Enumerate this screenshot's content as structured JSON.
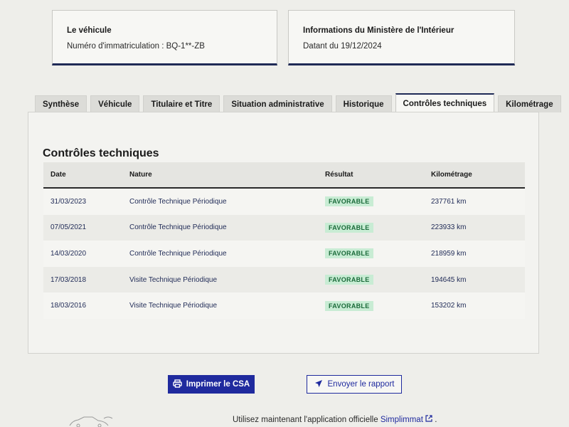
{
  "vehicle_card": {
    "title": "Le véhicule",
    "plate_line": "Numéro d'immatriculation : BQ-1**-ZB"
  },
  "ministry_card": {
    "title": "Informations du Ministère de l'Intérieur",
    "date_line": "Datant du 19/12/2024"
  },
  "tabs": [
    {
      "label": "Synthèse"
    },
    {
      "label": "Véhicule"
    },
    {
      "label": "Titulaire et Titre"
    },
    {
      "label": "Situation administrative"
    },
    {
      "label": "Historique"
    },
    {
      "label": "Contrôles techniques",
      "active": true
    },
    {
      "label": "Kilométrage"
    }
  ],
  "section": {
    "title": "Contrôles techniques",
    "columns": {
      "date": "Date",
      "nature": "Nature",
      "result": "Résultat",
      "mileage": "Kilométrage"
    },
    "rows": [
      {
        "date": "31/03/2023",
        "nature": "Contrôle Technique Périodique",
        "result": "FAVORABLE",
        "mileage": "237761 km"
      },
      {
        "date": "07/05/2021",
        "nature": "Contrôle Technique Périodique",
        "result": "FAVORABLE",
        "mileage": "223933 km"
      },
      {
        "date": "14/03/2020",
        "nature": "Contrôle Technique Périodique",
        "result": "FAVORABLE",
        "mileage": "218959 km"
      },
      {
        "date": "17/03/2018",
        "nature": "Visite Technique Périodique",
        "result": "FAVORABLE",
        "mileage": "194645 km"
      },
      {
        "date": "18/03/2016",
        "nature": "Visite Technique Périodique",
        "result": "FAVORABLE",
        "mileage": "153202 km"
      }
    ]
  },
  "buttons": {
    "print_label": "Imprimer le CSA",
    "send_label": "Envoyer le rapport"
  },
  "footer": {
    "text": "Utilisez maintenant l'application officielle ",
    "link_label": "Simplimmat",
    "end": "."
  },
  "colors": {
    "primary_blue": "#1f2a9e",
    "navy_border": "#1f2a56",
    "success_text": "#1b6b3a",
    "success_bg": "#c8ecd4"
  },
  "icons": {
    "print": "printer-icon",
    "send": "paper-plane-icon",
    "external": "external-link-icon"
  }
}
